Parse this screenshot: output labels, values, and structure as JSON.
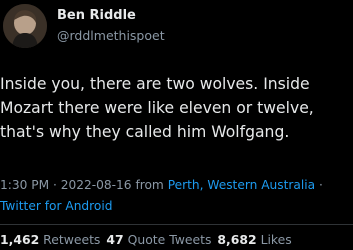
{
  "author": {
    "name": "Ben Riddle",
    "handle": "@rddlmethispoet"
  },
  "tweet": {
    "lines": [
      "Inside you, there are two wolves. Inside",
      "Mozart there were like eleven or twelve,",
      "that's why they called him Wolfgang."
    ],
    "time": "1:30 PM",
    "date": "2022-08-16",
    "from_word": "from",
    "location": "Perth, Western Australia",
    "client": "Twitter for Android",
    "separator": "·"
  },
  "stats": {
    "retweets_count": "1,462",
    "retweets_label": "Retweets",
    "quotes_count": "47",
    "quotes_label": "Quote Tweets",
    "likes_count": "8,682",
    "likes_label": "Likes"
  },
  "colors": {
    "background": "#000000",
    "text": "#e7e9ea",
    "muted": "#8b98a5",
    "link": "#1d9bf0"
  },
  "icons": {
    "avatar": "profile-photo"
  }
}
